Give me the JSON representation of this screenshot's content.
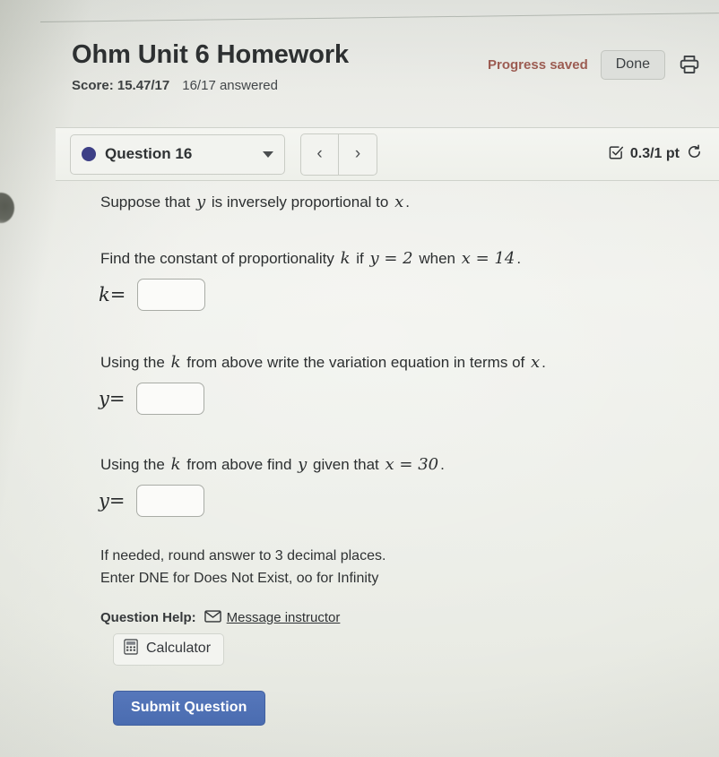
{
  "header": {
    "title": "Ohm Unit 6 Homework",
    "score_label": "Score: 15.47/17",
    "answered_label": "16/17 answered",
    "progress_saved": "Progress saved",
    "done_label": "Done",
    "print_icon": "printer-icon",
    "colors": {
      "progress_saved_text": "#9c5c52",
      "title_text": "#2d3031"
    }
  },
  "question_bar": {
    "selected_question": "Question 16",
    "status_dot_color": "#3d3f86",
    "dropdown_icon": "chevron-down-icon",
    "prev_label": "‹",
    "next_label": "›",
    "points_label": "0.3/1 pt",
    "graded_icon": "check-square-icon",
    "retry_icon": "retry-icon"
  },
  "question": {
    "intro": {
      "pre": "Suppose that",
      "var_y": "y",
      "mid": "is inversely proportional to",
      "var_x": "x",
      "period": "."
    },
    "part1": {
      "pre": "Find the constant of proportionality",
      "var_k": "k",
      "mid": "if",
      "eq_y": "y = 2",
      "when": "when",
      "eq_x": "x = 14",
      "period": ".",
      "answer_lhs_var": "k",
      "answer_lhs_eq": "=",
      "answer_value": "",
      "answer_placeholder": ""
    },
    "part2": {
      "pre": "Using the",
      "var_k": "k",
      "mid": "from above write the variation equation in terms of",
      "var_x": "x",
      "period": ".",
      "answer_lhs_var": "y",
      "answer_lhs_eq": "=",
      "answer_value": "",
      "answer_placeholder": ""
    },
    "part3": {
      "pre": "Using the",
      "var_k": "k",
      "mid": "from above find",
      "var_y": "y",
      "mid2": "given that",
      "eq_x": "x = 30",
      "period": ".",
      "answer_lhs_var": "y",
      "answer_lhs_eq": "=",
      "answer_value": "",
      "answer_placeholder": ""
    },
    "notes": [
      "If needed, round answer to 3 decimal places.",
      "Enter DNE for Does Not Exist, oo for Infinity"
    ]
  },
  "footer": {
    "help_label": "Question Help:",
    "message_instructor": "Message instructor",
    "envelope_icon": "envelope-icon",
    "calculator_label": "Calculator",
    "calculator_icon": "calculator-icon",
    "submit_label": "Submit Question",
    "submit_color": "#4a6cb0"
  }
}
